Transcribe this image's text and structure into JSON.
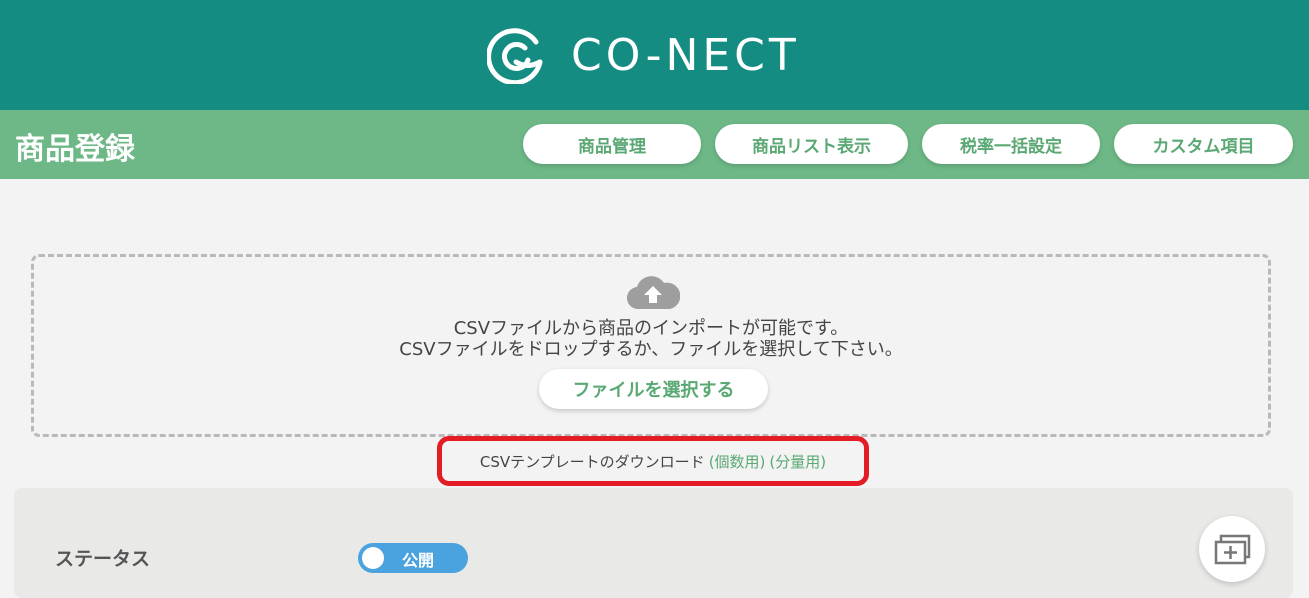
{
  "header": {
    "brand": "CO-NECT",
    "page_title": "商品登録",
    "nav": [
      {
        "label": "商品管理"
      },
      {
        "label": "商品リスト表示"
      },
      {
        "label": "税率一括設定"
      },
      {
        "label": "カスタム項目"
      }
    ]
  },
  "upload": {
    "line1": "CSVファイルから商品のインポートが可能です。",
    "line2": "CSVファイルをドロップするか、ファイルを選択して下さい。",
    "select_button": "ファイルを選択する",
    "template_text": "CSVテンプレートのダウンロード",
    "template_link_individual": "(個数用)",
    "template_link_quantity": "(分量用)"
  },
  "form": {
    "status_label": "ステータス",
    "status_value": "公開"
  },
  "colors": {
    "header_bg": "#148c82",
    "subbar_bg": "#6db886",
    "accent_green": "#5aa873",
    "toggle_blue": "#4aa3df",
    "highlight_red": "#e31c25"
  },
  "icons": {
    "logo": "conect-logo-icon",
    "cloud": "cloud-upload-icon",
    "add": "add-window-icon"
  }
}
